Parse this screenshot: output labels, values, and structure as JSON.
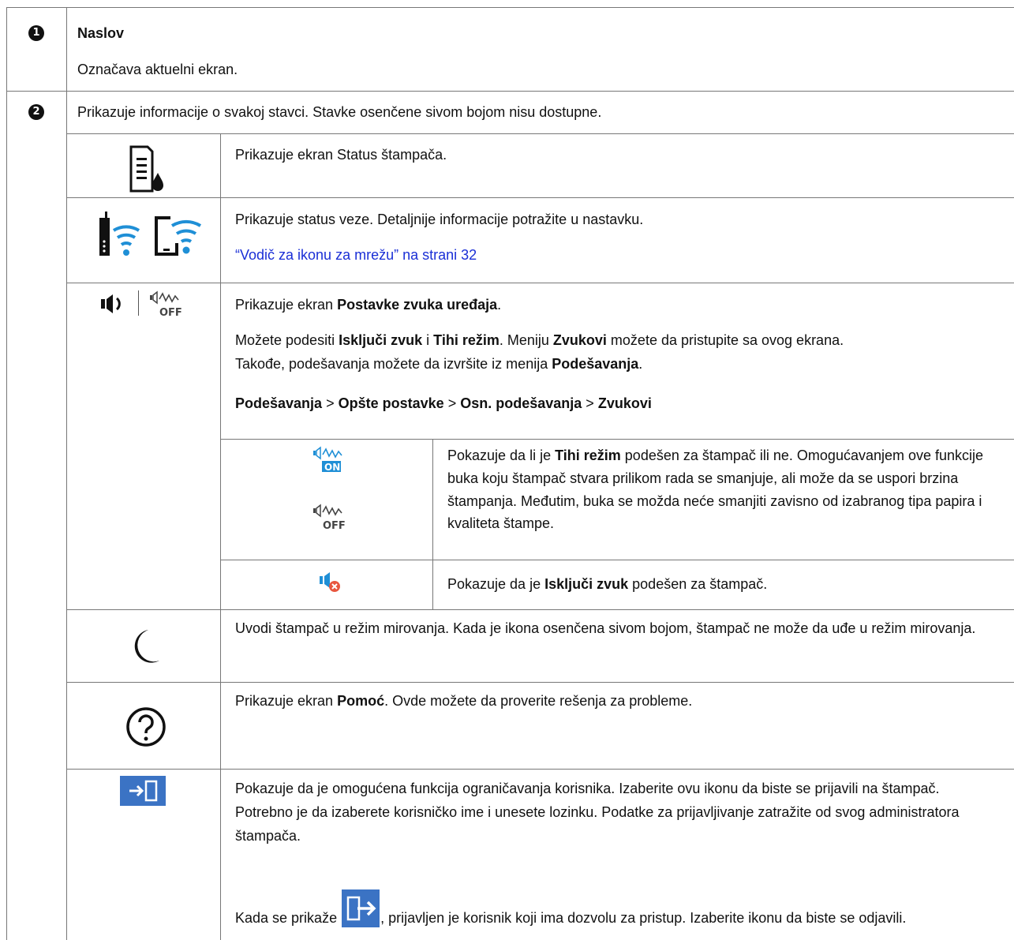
{
  "row1": {
    "number": "1",
    "title": "Naslov",
    "description": "Označava aktuelni ekran."
  },
  "row2": {
    "number": "2",
    "intro": "Prikazuje informacije o svakoj stavci. Stavke osenčene sivom bojom nisu dostupne.",
    "items": {
      "printer_status": {
        "icon": "printer-ink-status-icon",
        "text": "Prikazuje ekran Status štampača."
      },
      "network": {
        "icons": [
          "wifi-printer-icon",
          "wifi-direct-device-icon"
        ],
        "text": "Prikazuje status veze. Detaljnije informacije potražite u nastavku.",
        "link": "“Vodič za ikonu za mrežu” na strani 32"
      },
      "sound": {
        "icons": [
          "speaker-on-icon",
          "quiet-off-icon"
        ],
        "line1_a": "Prikazuje ekran ",
        "line1_b": "Postavke zvuka uređaja",
        "line1_c": ".",
        "line2_a": "Možete podesiti ",
        "line2_b": "Isključi zvuk",
        "line2_c": " i ",
        "line2_d": "Tihi režim",
        "line2_e": ". Meniju ",
        "line2_f": "Zvukovi",
        "line2_g": " možete da pristupite sa ovog ekrana.",
        "line3_a": "Takođe, podešavanja možete da izvršite iz menija ",
        "line3_b": "Podešavanja",
        "line3_c": ".",
        "path": [
          "Podešavanja",
          "Opšte postavke",
          "Osn. podešavanja",
          "Zvukovi"
        ],
        "path_sep": ">",
        "quiet": {
          "icons": [
            "quiet-on-icon",
            "quiet-off-icon"
          ],
          "on_label": "ON",
          "off_label": "OFF",
          "a": "Pokazuje da li je ",
          "b": "Tihi režim",
          "c": " podešen za štampač ili ne. Omogućavanjem ove funkcije buka koju štampač stvara prilikom rada se smanjuje, ali može da se uspori brzina štampanja. Međutim, buka se možda neće smanjiti zavisno od izabranog tipa papira i kvaliteta štampe."
        },
        "mute": {
          "icon": "mute-icon",
          "a": "Pokazuje da je ",
          "b": "Isključi zvuk",
          "c": " podešen za štampač."
        }
      },
      "sleep": {
        "icon": "moon-sleep-icon",
        "text": "Uvodi štampač u režim mirovanja. Kada je ikona osenčena sivom bojom, štampač ne može da uđe u režim mirovanja."
      },
      "help": {
        "icon": "help-question-icon",
        "a": "Prikazuje ekran ",
        "b": "Pomoć",
        "c": ". Ovde možete da proverite rešenja za probleme."
      },
      "login": {
        "icon": "login-icon",
        "text": "Pokazuje da je omogućena funkcija ograničavanja korisnika. Izaberite ovu ikonu da biste se prijavili na štampač. Potrebno je da izaberete korisničko ime i unesete lozinku. Podatke za prijavljivanje zatražite od svog administratora štampača.",
        "logout_icon": "logout-icon",
        "logout_a": "Kada se prikaže ",
        "logout_b": ", prijavljen je korisnik koji ima dozvolu za pristup. Izaberite ikonu da biste se odjavili."
      }
    }
  },
  "colors": {
    "border": "#777777",
    "link": "#1a2fd6",
    "icon_blue": "#1f8fd6",
    "login_bg": "#3b73c4",
    "mute_badge": "#e8573f"
  }
}
